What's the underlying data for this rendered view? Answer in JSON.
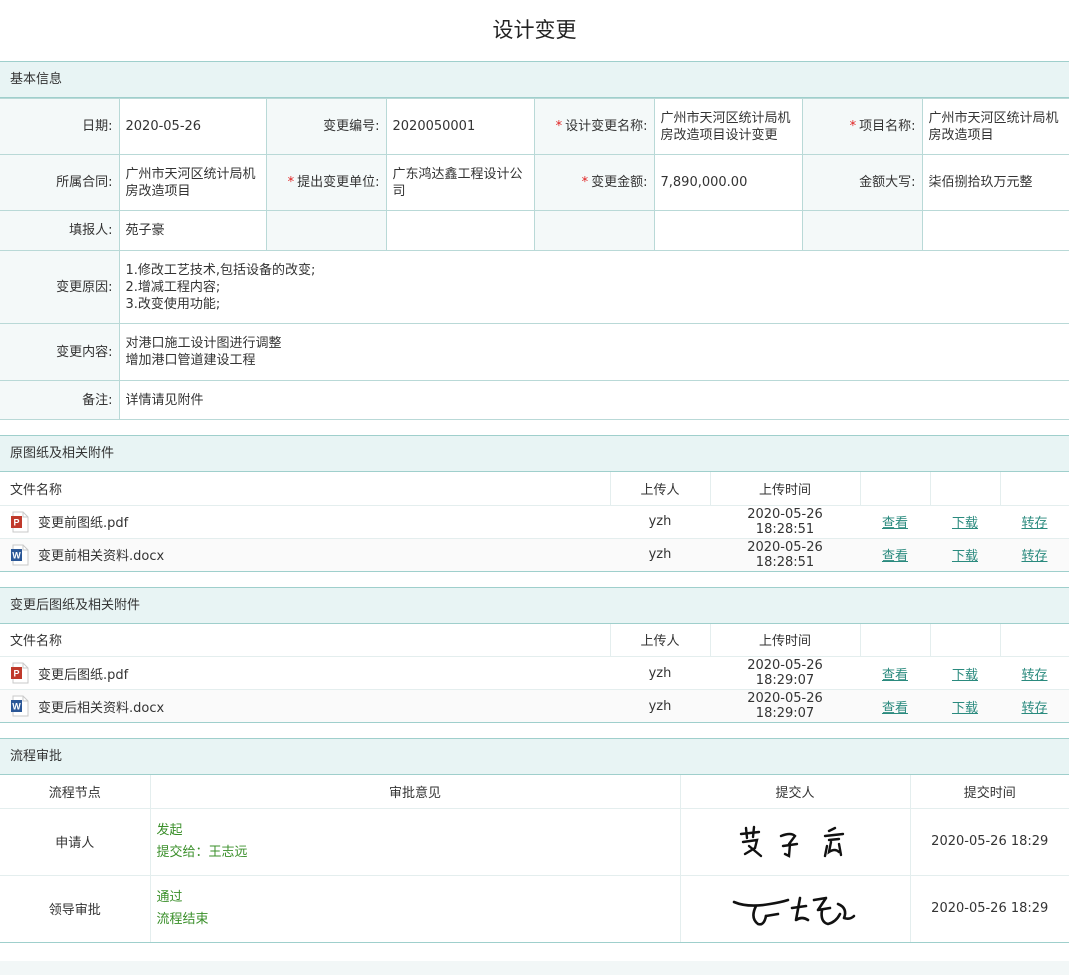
{
  "page": {
    "title": "设计变更"
  },
  "sections": {
    "basic": "基本信息",
    "original": "原图纸及相关附件",
    "changed": "变更后图纸及相关附件",
    "process": "流程审批"
  },
  "basic_info": {
    "date_label": "日期:",
    "date_value": "2020-05-26",
    "change_no_label": "变更编号:",
    "change_no_value": "2020050001",
    "change_name_label": "设计变更名称:",
    "change_name_value": "广州市天河区统计局机房改造项目设计变更",
    "project_name_label": "项目名称:",
    "project_name_value": "广州市天河区统计局机房改造项目",
    "contract_label": "所属合同:",
    "contract_value": "广州市天河区统计局机房改造项目",
    "unit_label": "提出变更单位:",
    "unit_value": "广东鸿达鑫工程设计公司",
    "amount_label": "变更金额:",
    "amount_value": "7,890,000.00",
    "amount_upper_label": "金额大写:",
    "amount_upper_value": "柒佰捌拾玖万元整",
    "reporter_label": "填报人:",
    "reporter_value": "苑子豪",
    "reason_label": "变更原因:",
    "reason_lines": [
      "1.修改工艺技术,包括设备的改变;",
      "2.增减工程内容;",
      "3.改变使用功能;"
    ],
    "content_label": "变更内容:",
    "content_lines": [
      "对港口施工设计图进行调整",
      "增加港口管道建设工程"
    ],
    "remark_label": "备注:",
    "remark_value": "详情请见附件",
    "required_mark": "*"
  },
  "file_table": {
    "col_name": "文件名称",
    "col_uploader": "上传人",
    "col_time": "上传时间",
    "action_view": "查看",
    "action_download": "下载",
    "action_transfer": "转存"
  },
  "original_files": [
    {
      "name": "变更前图纸.pdf",
      "type": "pdf-icon",
      "uploader": "yzh",
      "time": "2020-05-26 18:28:51"
    },
    {
      "name": "变更前相关资料.docx",
      "type": "word-icon",
      "uploader": "yzh",
      "time": "2020-05-26 18:28:51"
    }
  ],
  "changed_files": [
    {
      "name": "变更后图纸.pdf",
      "type": "pdf-icon",
      "uploader": "yzh",
      "time": "2020-05-26 18:29:07"
    },
    {
      "name": "变更后相关资料.docx",
      "type": "word-icon",
      "uploader": "yzh",
      "time": "2020-05-26 18:29:07"
    }
  ],
  "process": {
    "col_node": "流程节点",
    "col_opinion": "审批意见",
    "col_submitter": "提交人",
    "col_time": "提交时间",
    "rows": [
      {
        "node": "申请人",
        "opinion_1": "发起",
        "opinion_2": "提交给：王志远",
        "signature": "苑子豪",
        "time": "2020-05-26 18:29"
      },
      {
        "node": "领导审批",
        "opinion_1": "通过",
        "opinion_2": "流程结束",
        "signature": "王志远",
        "time": "2020-05-26 18:29"
      }
    ]
  },
  "colors": {
    "accent": "#2a8a7e",
    "section_bg": "#e8f4f4",
    "border": "#9fcfcc",
    "required": "#e02020",
    "approval_text": "#3a8f2a"
  }
}
